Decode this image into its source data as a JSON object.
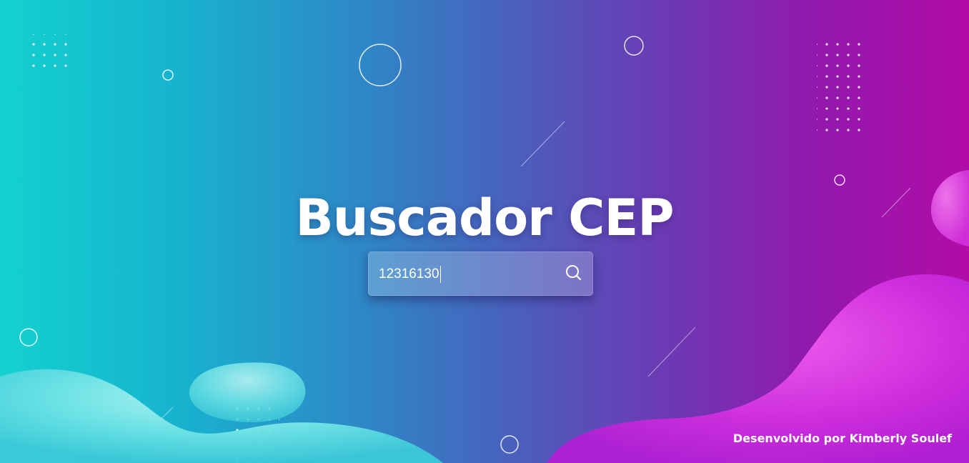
{
  "header": {
    "title": "Buscador CEP"
  },
  "search": {
    "value": "12316130",
    "icon": "search-icon"
  },
  "footer": {
    "credit": "Desenvolvido por Kimberly Soulef"
  },
  "theme": {
    "gradient_start": "#13d1cf",
    "gradient_mid": "#4862bd",
    "gradient_end": "#b20ca8",
    "text": "#ffffff"
  }
}
